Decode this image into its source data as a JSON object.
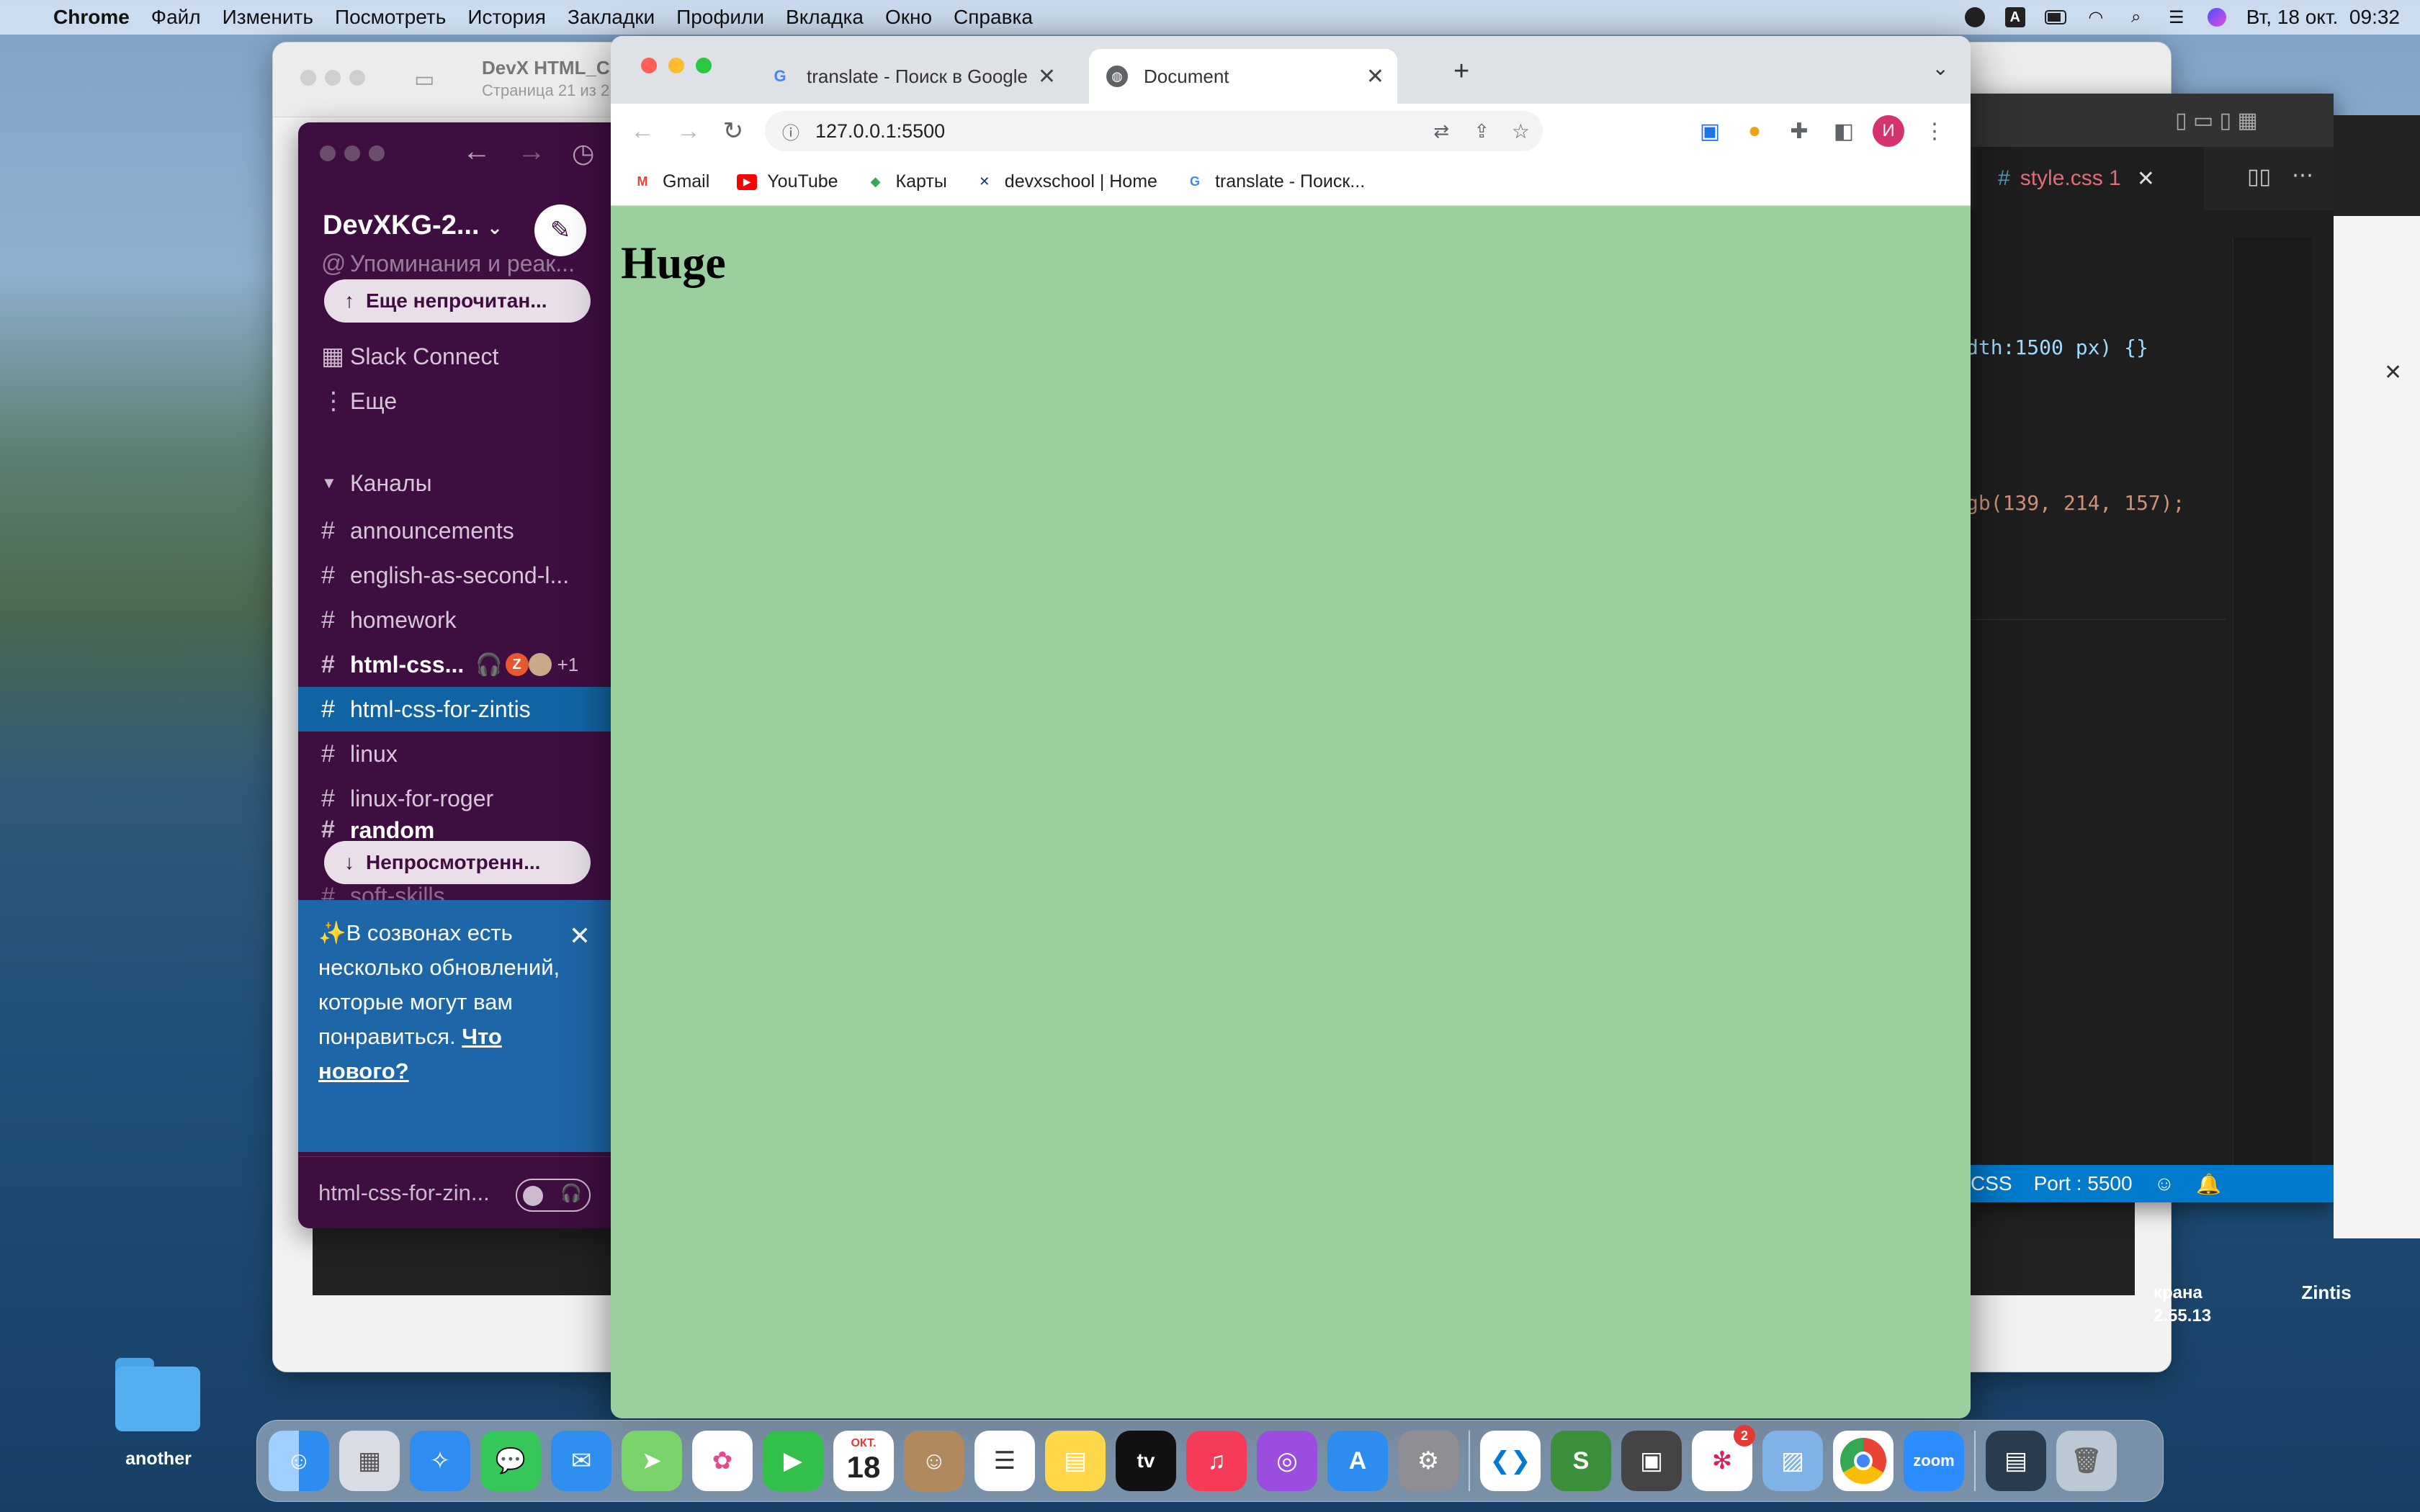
{
  "menubar": {
    "apple": "",
    "app": "Chrome",
    "items": [
      "Файл",
      "Изменить",
      "Посмотреть",
      "История",
      "Закладки",
      "Профили",
      "Вкладка",
      "Окно",
      "Справка"
    ],
    "input_badge": "A",
    "clock": "Вт, 18 окт.  09:32"
  },
  "pdf": {
    "title": "DevX HTML_C",
    "subtitle": "Страница 21 из 2"
  },
  "vscode": {
    "tab": "style.css 1",
    "code_line1": "dth:1500 px) {}",
    "code_line2": "gb(139, 214, 157);",
    "status_lang": "CSS",
    "status_port": "Port : 5500"
  },
  "desktop": {
    "zintis": "Zintis",
    "screen_label1": "крана",
    "screen_label2": "2.55.13",
    "folder": "another"
  },
  "slack": {
    "workspace": "DevXKG-2...",
    "mentions": "Упоминания и реак...",
    "unread_pill": "Еще непрочитан...",
    "slack_connect": "Slack Connect",
    "more": "Еще",
    "channels_header": "Каналы",
    "channels": [
      {
        "name": "announcements"
      },
      {
        "name": "english-as-second-l..."
      },
      {
        "name": "homework"
      },
      {
        "name": "html-css..."
      },
      {
        "name": "html-css-for-zintis"
      },
      {
        "name": "linux"
      },
      {
        "name": "linux-for-roger"
      },
      {
        "name": "random"
      },
      {
        "name": "soft-skills"
      }
    ],
    "huddle_count": "+1",
    "unseen_pill": "Непросмотренн...",
    "promo_text": "В созвонах есть несколько обновлений, которые могут вам понравиться. ",
    "promo_link": "Что нового?",
    "huddle_channel": "html-css-for-zin..."
  },
  "chrome": {
    "tabs": [
      {
        "title": "translate - Поиск в Google"
      },
      {
        "title": "Document"
      }
    ],
    "url": "127.0.0.1:5500",
    "profile_initial": "И",
    "bookmarks": [
      {
        "label": "Gmail"
      },
      {
        "label": "YouTube"
      },
      {
        "label": "Карты"
      },
      {
        "label": "devxschool | Home"
      },
      {
        "label": "translate - Поиск..."
      }
    ],
    "page_heading": "Huge",
    "page_bg": "#9ad09d"
  },
  "dock": {
    "apps": [
      "finder",
      "launchpad",
      "safari",
      "messages",
      "mail",
      "maps",
      "photos",
      "facetime",
      "calendar",
      "contacts",
      "reminders",
      "notes",
      "apple-tv",
      "music",
      "podcasts",
      "app-store",
      "system-preferences",
      "vscode",
      "sublime",
      "screenshot",
      "slack",
      "preview",
      "chrome",
      "zoom",
      "wallet",
      "trash"
    ],
    "calendar_month": "ОКТ.",
    "calendar_day": "18",
    "tv_label": "tv",
    "zoom_label": "zoom",
    "slack_badge": "2"
  }
}
